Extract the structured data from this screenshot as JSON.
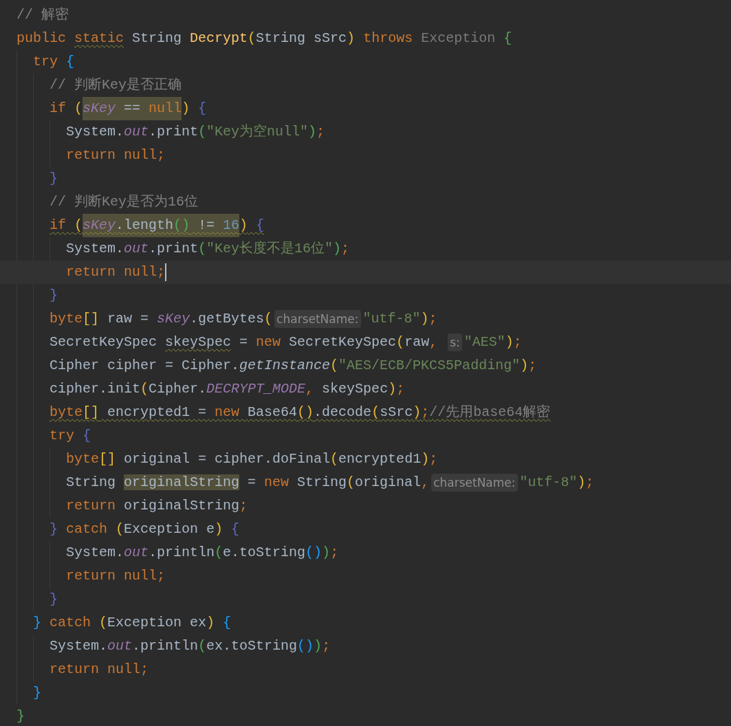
{
  "editor": {
    "lines": [
      {
        "tokens": [
          {
            "kind": "comment",
            "text": "// 解密"
          }
        ]
      },
      {
        "tokens": [
          {
            "kind": "keyword",
            "text": "public "
          },
          {
            "kind": "keyword",
            "text": "static",
            "warning": true
          },
          {
            "kind": "plain",
            "text": " String "
          },
          {
            "kind": "function",
            "text": "Decrypt"
          },
          {
            "kind": "bracket",
            "text": "(",
            "color": "#e8ba36"
          },
          {
            "kind": "plain",
            "text": "String sSrc"
          },
          {
            "kind": "bracket",
            "text": ")",
            "color": "#e8ba36"
          },
          {
            "kind": "keyword",
            "text": " throws "
          },
          {
            "kind": "dim",
            "text": "Exception"
          },
          {
            "kind": "bracket",
            "text": " {",
            "color": "#54a857"
          }
        ],
        "children": [
          {
            "tokens": [
              {
                "kind": "keyword",
                "text": "try "
              },
              {
                "kind": "bracket",
                "text": "{",
                "color": "#179fff"
              }
            ],
            "children": [
              {
                "tokens": [
                  {
                    "kind": "comment",
                    "text": "// 判断Key是否正确"
                  }
                ]
              },
              {
                "tokens": [
                  {
                    "kind": "keyword",
                    "text": "if "
                  },
                  {
                    "kind": "bracket",
                    "text": "(",
                    "color": "#e8ba36"
                  },
                  {
                    "kind": "field",
                    "text": "sKey",
                    "highlight": true
                  },
                  {
                    "kind": "plain",
                    "text": " == ",
                    "highlight": true
                  },
                  {
                    "kind": "keyword",
                    "text": "null",
                    "highlight": true
                  },
                  {
                    "kind": "bracket",
                    "text": ")",
                    "color": "#e8ba36"
                  },
                  {
                    "kind": "bracket",
                    "text": " {",
                    "color": "#5c6bc0"
                  }
                ],
                "children": [
                  {
                    "tokens": [
                      {
                        "kind": "plain",
                        "text": "System."
                      },
                      {
                        "kind": "field",
                        "text": "out"
                      },
                      {
                        "kind": "plain",
                        "text": ".print"
                      },
                      {
                        "kind": "bracket",
                        "text": "(",
                        "color": "#54a857"
                      },
                      {
                        "kind": "string",
                        "text": "\"Key为空null\""
                      },
                      {
                        "kind": "bracket",
                        "text": ")",
                        "color": "#54a857"
                      },
                      {
                        "kind": "keyword",
                        "text": ";"
                      }
                    ]
                  },
                  {
                    "tokens": [
                      {
                        "kind": "keyword",
                        "text": "return null;"
                      }
                    ]
                  }
                ]
              },
              {
                "tokens": [
                  {
                    "kind": "bracket",
                    "text": "}",
                    "color": "#5c6bc0"
                  }
                ]
              },
              {
                "tokens": [
                  {
                    "kind": "comment",
                    "text": "// 判断Key是否为16位"
                  }
                ]
              },
              {
                "tokens": [
                  {
                    "kind": "keyword",
                    "text": "if ",
                    "warning": true
                  },
                  {
                    "kind": "bracket",
                    "text": "(",
                    "color": "#e8ba36",
                    "warning": true
                  },
                  {
                    "kind": "field",
                    "text": "sKey",
                    "highlight": true,
                    "warning": true
                  },
                  {
                    "kind": "plain",
                    "text": ".length",
                    "highlight": true,
                    "warning": true
                  },
                  {
                    "kind": "bracket",
                    "text": "()",
                    "color": "#54a857",
                    "highlight": true,
                    "warning": true
                  },
                  {
                    "kind": "plain",
                    "text": " != ",
                    "highlight": true,
                    "warning": true
                  },
                  {
                    "kind": "number",
                    "text": "16",
                    "highlight": true,
                    "warning": true
                  },
                  {
                    "kind": "bracket",
                    "text": ")",
                    "color": "#e8ba36",
                    "warning": true
                  },
                  {
                    "kind": "bracket",
                    "text": " {",
                    "color": "#5c6bc0",
                    "warning": true
                  }
                ],
                "children": [
                  {
                    "tokens": [
                      {
                        "kind": "plain",
                        "text": "System."
                      },
                      {
                        "kind": "field",
                        "text": "out"
                      },
                      {
                        "kind": "plain",
                        "text": ".print"
                      },
                      {
                        "kind": "bracket",
                        "text": "(",
                        "color": "#54a857"
                      },
                      {
                        "kind": "string",
                        "text": "\"Key长度不是16位\""
                      },
                      {
                        "kind": "bracket",
                        "text": ")",
                        "color": "#54a857"
                      },
                      {
                        "kind": "keyword",
                        "text": ";"
                      }
                    ]
                  },
                  {
                    "current": true,
                    "tokens": [
                      {
                        "kind": "keyword",
                        "text": "return null;"
                      },
                      {
                        "kind": "caret"
                      }
                    ]
                  }
                ]
              },
              {
                "tokens": [
                  {
                    "kind": "bracket",
                    "text": "}",
                    "color": "#5c6bc0"
                  }
                ]
              },
              {
                "tokens": [
                  {
                    "kind": "keyword",
                    "text": "byte"
                  },
                  {
                    "kind": "bracket",
                    "text": "[]",
                    "color": "#e8ba36"
                  },
                  {
                    "kind": "plain",
                    "text": " raw = "
                  },
                  {
                    "kind": "field",
                    "text": "sKey"
                  },
                  {
                    "kind": "plain",
                    "text": ".getBytes"
                  },
                  {
                    "kind": "bracket",
                    "text": "(",
                    "color": "#e8ba36"
                  },
                  {
                    "kind": "hint",
                    "text": "charsetName:"
                  },
                  {
                    "kind": "string",
                    "text": "\"utf-8\""
                  },
                  {
                    "kind": "bracket",
                    "text": ")",
                    "color": "#e8ba36"
                  },
                  {
                    "kind": "keyword",
                    "text": ";"
                  }
                ]
              },
              {
                "tokens": [
                  {
                    "kind": "plain",
                    "text": "SecretKeySpec "
                  },
                  {
                    "kind": "plain",
                    "text": "skeySpec",
                    "warning": true
                  },
                  {
                    "kind": "plain",
                    "text": " = "
                  },
                  {
                    "kind": "keyword",
                    "text": "new "
                  },
                  {
                    "kind": "plain",
                    "text": "SecretKeySpec"
                  },
                  {
                    "kind": "bracket",
                    "text": "(",
                    "color": "#e8ba36"
                  },
                  {
                    "kind": "plain",
                    "text": "raw"
                  },
                  {
                    "kind": "keyword",
                    "text": ", "
                  },
                  {
                    "kind": "hint",
                    "text": "s:"
                  },
                  {
                    "kind": "string",
                    "text": "\"AES\""
                  },
                  {
                    "kind": "bracket",
                    "text": ")",
                    "color": "#e8ba36"
                  },
                  {
                    "kind": "keyword",
                    "text": ";"
                  }
                ]
              },
              {
                "tokens": [
                  {
                    "kind": "plain",
                    "text": "Cipher cipher = Cipher."
                  },
                  {
                    "kind": "italic",
                    "text": "getInstance"
                  },
                  {
                    "kind": "bracket",
                    "text": "(",
                    "color": "#e8ba36"
                  },
                  {
                    "kind": "string",
                    "text": "\"AES/ECB/PKCS5Padding\""
                  },
                  {
                    "kind": "bracket",
                    "text": ")",
                    "color": "#e8ba36"
                  },
                  {
                    "kind": "keyword",
                    "text": ";"
                  }
                ]
              },
              {
                "tokens": [
                  {
                    "kind": "plain",
                    "text": "cipher.init"
                  },
                  {
                    "kind": "bracket",
                    "text": "(",
                    "color": "#e8ba36"
                  },
                  {
                    "kind": "plain",
                    "text": "Cipher."
                  },
                  {
                    "kind": "field",
                    "text": "DECRYPT_MODE"
                  },
                  {
                    "kind": "keyword",
                    "text": ","
                  },
                  {
                    "kind": "plain",
                    "text": " skeySpec"
                  },
                  {
                    "kind": "bracket",
                    "text": ")",
                    "color": "#e8ba36"
                  },
                  {
                    "kind": "keyword",
                    "text": ";"
                  }
                ]
              },
              {
                "tokens": [
                  {
                    "kind": "keyword",
                    "text": "byte",
                    "warning": true
                  },
                  {
                    "kind": "bracket",
                    "text": "[]",
                    "color": "#e8ba36",
                    "warning": true
                  },
                  {
                    "kind": "plain",
                    "text": " encrypted1 = ",
                    "warning": true
                  },
                  {
                    "kind": "keyword",
                    "text": "new ",
                    "warning": true
                  },
                  {
                    "kind": "plain",
                    "text": "Base64",
                    "warning": true
                  },
                  {
                    "kind": "bracket",
                    "text": "()",
                    "color": "#e8ba36",
                    "warning": true
                  },
                  {
                    "kind": "plain",
                    "text": ".decode",
                    "warning": true
                  },
                  {
                    "kind": "bracket",
                    "text": "(",
                    "color": "#e8ba36",
                    "warning": true
                  },
                  {
                    "kind": "plain",
                    "text": "sSrc",
                    "warning": true
                  },
                  {
                    "kind": "bracket",
                    "text": ")",
                    "color": "#e8ba36",
                    "warning": true
                  },
                  {
                    "kind": "keyword",
                    "text": ";",
                    "warning": true
                  },
                  {
                    "kind": "comment",
                    "text": "//先用base64解密",
                    "warning": true
                  }
                ]
              },
              {
                "tokens": [
                  {
                    "kind": "keyword",
                    "text": "try "
                  },
                  {
                    "kind": "bracket",
                    "text": "{",
                    "color": "#5c6bc0"
                  }
                ],
                "children": [
                  {
                    "tokens": [
                      {
                        "kind": "keyword",
                        "text": "byte"
                      },
                      {
                        "kind": "bracket",
                        "text": "[]",
                        "color": "#e8ba36"
                      },
                      {
                        "kind": "plain",
                        "text": " original = cipher.doFinal"
                      },
                      {
                        "kind": "bracket",
                        "text": "(",
                        "color": "#e8ba36"
                      },
                      {
                        "kind": "plain",
                        "text": "encrypted1"
                      },
                      {
                        "kind": "bracket",
                        "text": ")",
                        "color": "#e8ba36"
                      },
                      {
                        "kind": "keyword",
                        "text": ";"
                      }
                    ]
                  },
                  {
                    "tokens": [
                      {
                        "kind": "plain",
                        "text": "String "
                      },
                      {
                        "kind": "plain",
                        "text": "originalString",
                        "highlight": true
                      },
                      {
                        "kind": "plain",
                        "text": " = "
                      },
                      {
                        "kind": "keyword",
                        "text": "new "
                      },
                      {
                        "kind": "plain",
                        "text": "String"
                      },
                      {
                        "kind": "bracket",
                        "text": "(",
                        "color": "#e8ba36"
                      },
                      {
                        "kind": "plain",
                        "text": "original"
                      },
                      {
                        "kind": "keyword",
                        "text": ","
                      },
                      {
                        "kind": "hint",
                        "text": "charsetName:"
                      },
                      {
                        "kind": "string",
                        "text": "\"utf-8\""
                      },
                      {
                        "kind": "bracket",
                        "text": ")",
                        "color": "#e8ba36"
                      },
                      {
                        "kind": "keyword",
                        "text": ";"
                      }
                    ]
                  },
                  {
                    "tokens": [
                      {
                        "kind": "keyword",
                        "text": "return "
                      },
                      {
                        "kind": "plain",
                        "text": "originalString"
                      },
                      {
                        "kind": "keyword",
                        "text": ";"
                      }
                    ]
                  }
                ]
              },
              {
                "tokens": [
                  {
                    "kind": "bracket",
                    "text": "}",
                    "color": "#5c6bc0"
                  },
                  {
                    "kind": "keyword",
                    "text": " catch "
                  },
                  {
                    "kind": "bracket",
                    "text": "(",
                    "color": "#e8ba36"
                  },
                  {
                    "kind": "plain",
                    "text": "Exception e"
                  },
                  {
                    "kind": "bracket",
                    "text": ")",
                    "color": "#e8ba36"
                  },
                  {
                    "kind": "bracket",
                    "text": " {",
                    "color": "#5c6bc0"
                  }
                ],
                "children": [
                  {
                    "tokens": [
                      {
                        "kind": "plain",
                        "text": "System."
                      },
                      {
                        "kind": "field",
                        "text": "out"
                      },
                      {
                        "kind": "plain",
                        "text": ".println"
                      },
                      {
                        "kind": "bracket",
                        "text": "(",
                        "color": "#54a857"
                      },
                      {
                        "kind": "plain",
                        "text": "e.toString"
                      },
                      {
                        "kind": "bracket",
                        "text": "()",
                        "color": "#179fff"
                      },
                      {
                        "kind": "bracket",
                        "text": ")",
                        "color": "#54a857"
                      },
                      {
                        "kind": "keyword",
                        "text": ";"
                      }
                    ]
                  },
                  {
                    "tokens": [
                      {
                        "kind": "keyword",
                        "text": "return null;"
                      }
                    ]
                  }
                ]
              },
              {
                "tokens": [
                  {
                    "kind": "bracket",
                    "text": "}",
                    "color": "#5c6bc0"
                  }
                ]
              }
            ]
          },
          {
            "tokens": [
              {
                "kind": "bracket",
                "text": "}",
                "color": "#179fff"
              },
              {
                "kind": "keyword",
                "text": " catch "
              },
              {
                "kind": "bracket",
                "text": "(",
                "color": "#e8ba36"
              },
              {
                "kind": "plain",
                "text": "Exception ex"
              },
              {
                "kind": "bracket",
                "text": ")",
                "color": "#e8ba36"
              },
              {
                "kind": "bracket",
                "text": " {",
                "color": "#179fff"
              }
            ],
            "children": [
              {
                "tokens": [
                  {
                    "kind": "plain",
                    "text": "System."
                  },
                  {
                    "kind": "field",
                    "text": "out"
                  },
                  {
                    "kind": "plain",
                    "text": ".println"
                  },
                  {
                    "kind": "bracket",
                    "text": "(",
                    "color": "#54a857"
                  },
                  {
                    "kind": "plain",
                    "text": "ex.toString"
                  },
                  {
                    "kind": "bracket",
                    "text": "()",
                    "color": "#179fff"
                  },
                  {
                    "kind": "bracket",
                    "text": ")",
                    "color": "#54a857"
                  },
                  {
                    "kind": "keyword",
                    "text": ";"
                  }
                ]
              },
              {
                "tokens": [
                  {
                    "kind": "keyword",
                    "text": "return null;"
                  }
                ]
              }
            ]
          },
          {
            "tokens": [
              {
                "kind": "bracket",
                "text": "}",
                "color": "#179fff"
              }
            ]
          }
        ]
      },
      {
        "tokens": [
          {
            "kind": "bracket",
            "text": "}",
            "color": "#54a857"
          }
        ]
      }
    ]
  }
}
